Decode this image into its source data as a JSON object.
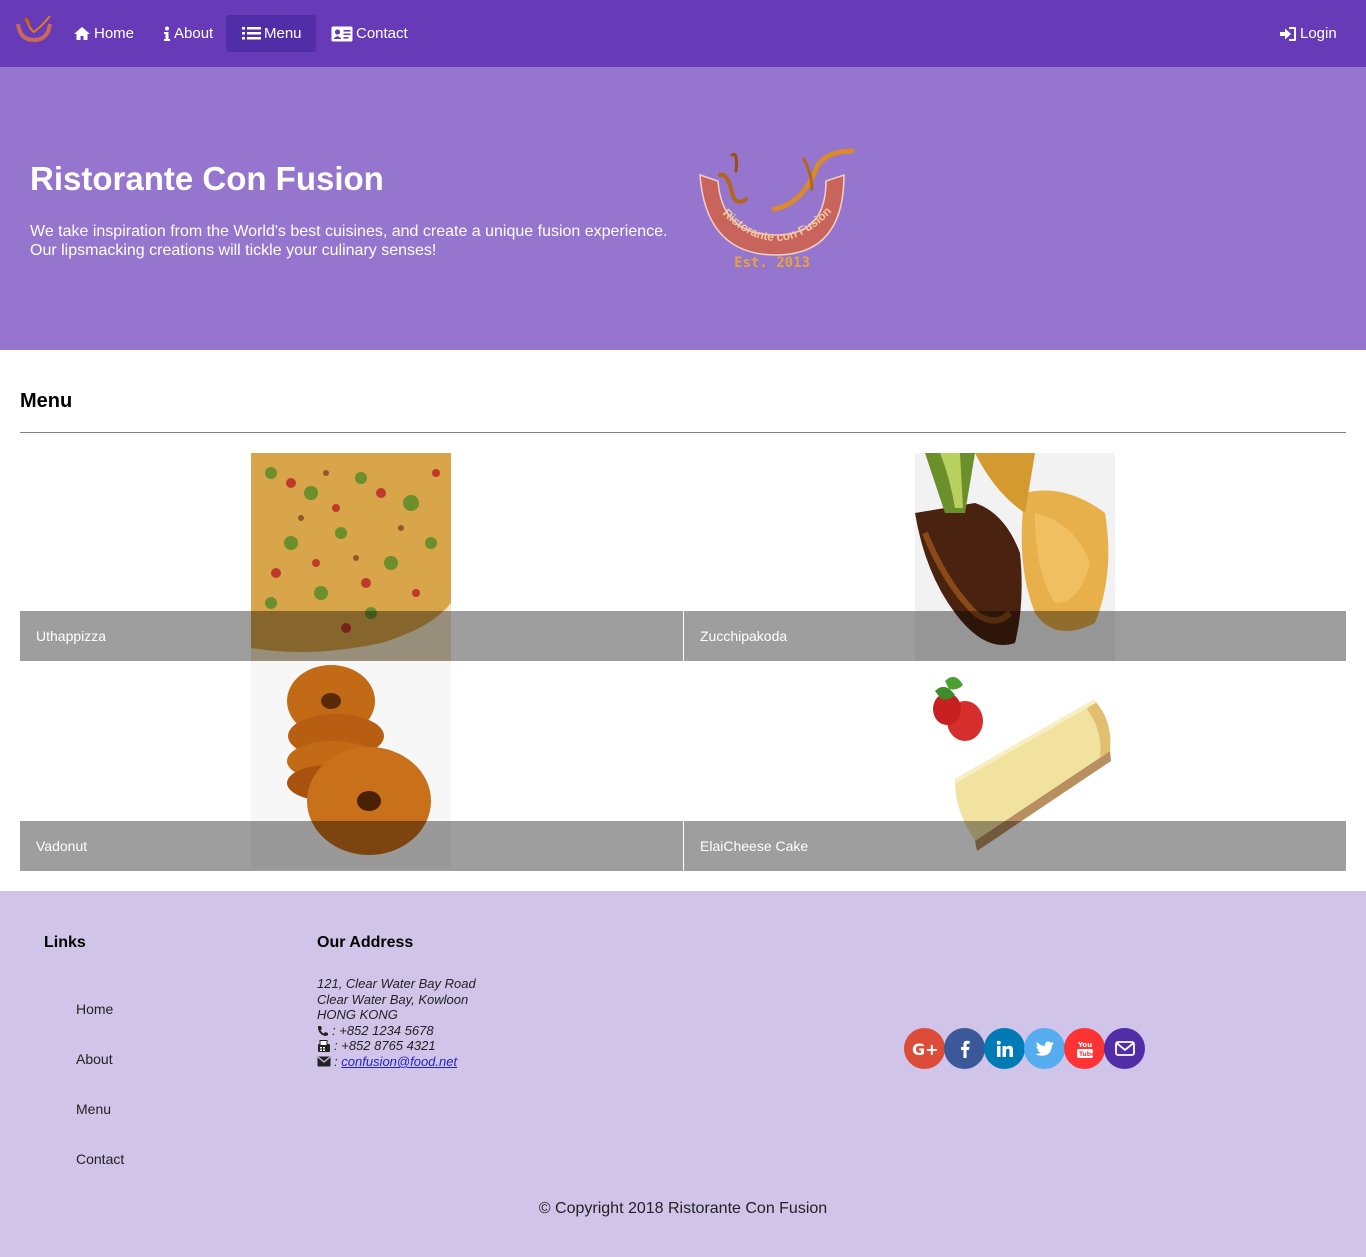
{
  "navbar": {
    "items": [
      {
        "label": "Home",
        "icon": "home-icon"
      },
      {
        "label": "About",
        "icon": "info-icon"
      },
      {
        "label": "Menu",
        "icon": "list-icon"
      },
      {
        "label": "Contact",
        "icon": "address-card-icon"
      }
    ],
    "active": "Menu",
    "login_label": "Login"
  },
  "jumbotron": {
    "title": "Ristorante Con Fusion",
    "text_line1": "We take inspiration from the World's best cuisines, and create a unique fusion experience.",
    "text_line2": "Our lipsmacking creations will tickle your culinary senses!",
    "logo_text": "Ristorante con Fusion",
    "logo_est": "Est. 2013"
  },
  "menu": {
    "title": "Menu",
    "dishes": [
      {
        "name": "Uthappizza"
      },
      {
        "name": "Zucchipakoda"
      },
      {
        "name": "Vadonut"
      },
      {
        "name": "ElaiCheese Cake"
      }
    ]
  },
  "footer": {
    "links_title": "Links",
    "links": [
      "Home",
      "About",
      "Menu",
      "Contact"
    ],
    "address_title": "Our Address",
    "address_lines": [
      "121, Clear Water Bay Road",
      "Clear Water Bay, Kowloon",
      "HONG KONG"
    ],
    "phone": ": +852 1234 5678",
    "fax": ": +852 8765 4321",
    "email_prefix": ":",
    "email": "confusion@food.net",
    "socials": [
      {
        "name": "google-plus",
        "color": "#dd4b39"
      },
      {
        "name": "facebook",
        "color": "#3b5998"
      },
      {
        "name": "linkedin",
        "color": "#007bb6"
      },
      {
        "name": "twitter",
        "color": "#55acee"
      },
      {
        "name": "youtube",
        "color": "#ff3333"
      },
      {
        "name": "email",
        "color": "#512DA8"
      }
    ],
    "copyright": "© Copyright 2018 Ristorante Con Fusion"
  },
  "colors": {
    "primary": "#673AB7",
    "primary_dark": "#512DA8",
    "jumbotron": "#9575CD",
    "footer": "#D1C4E9"
  }
}
